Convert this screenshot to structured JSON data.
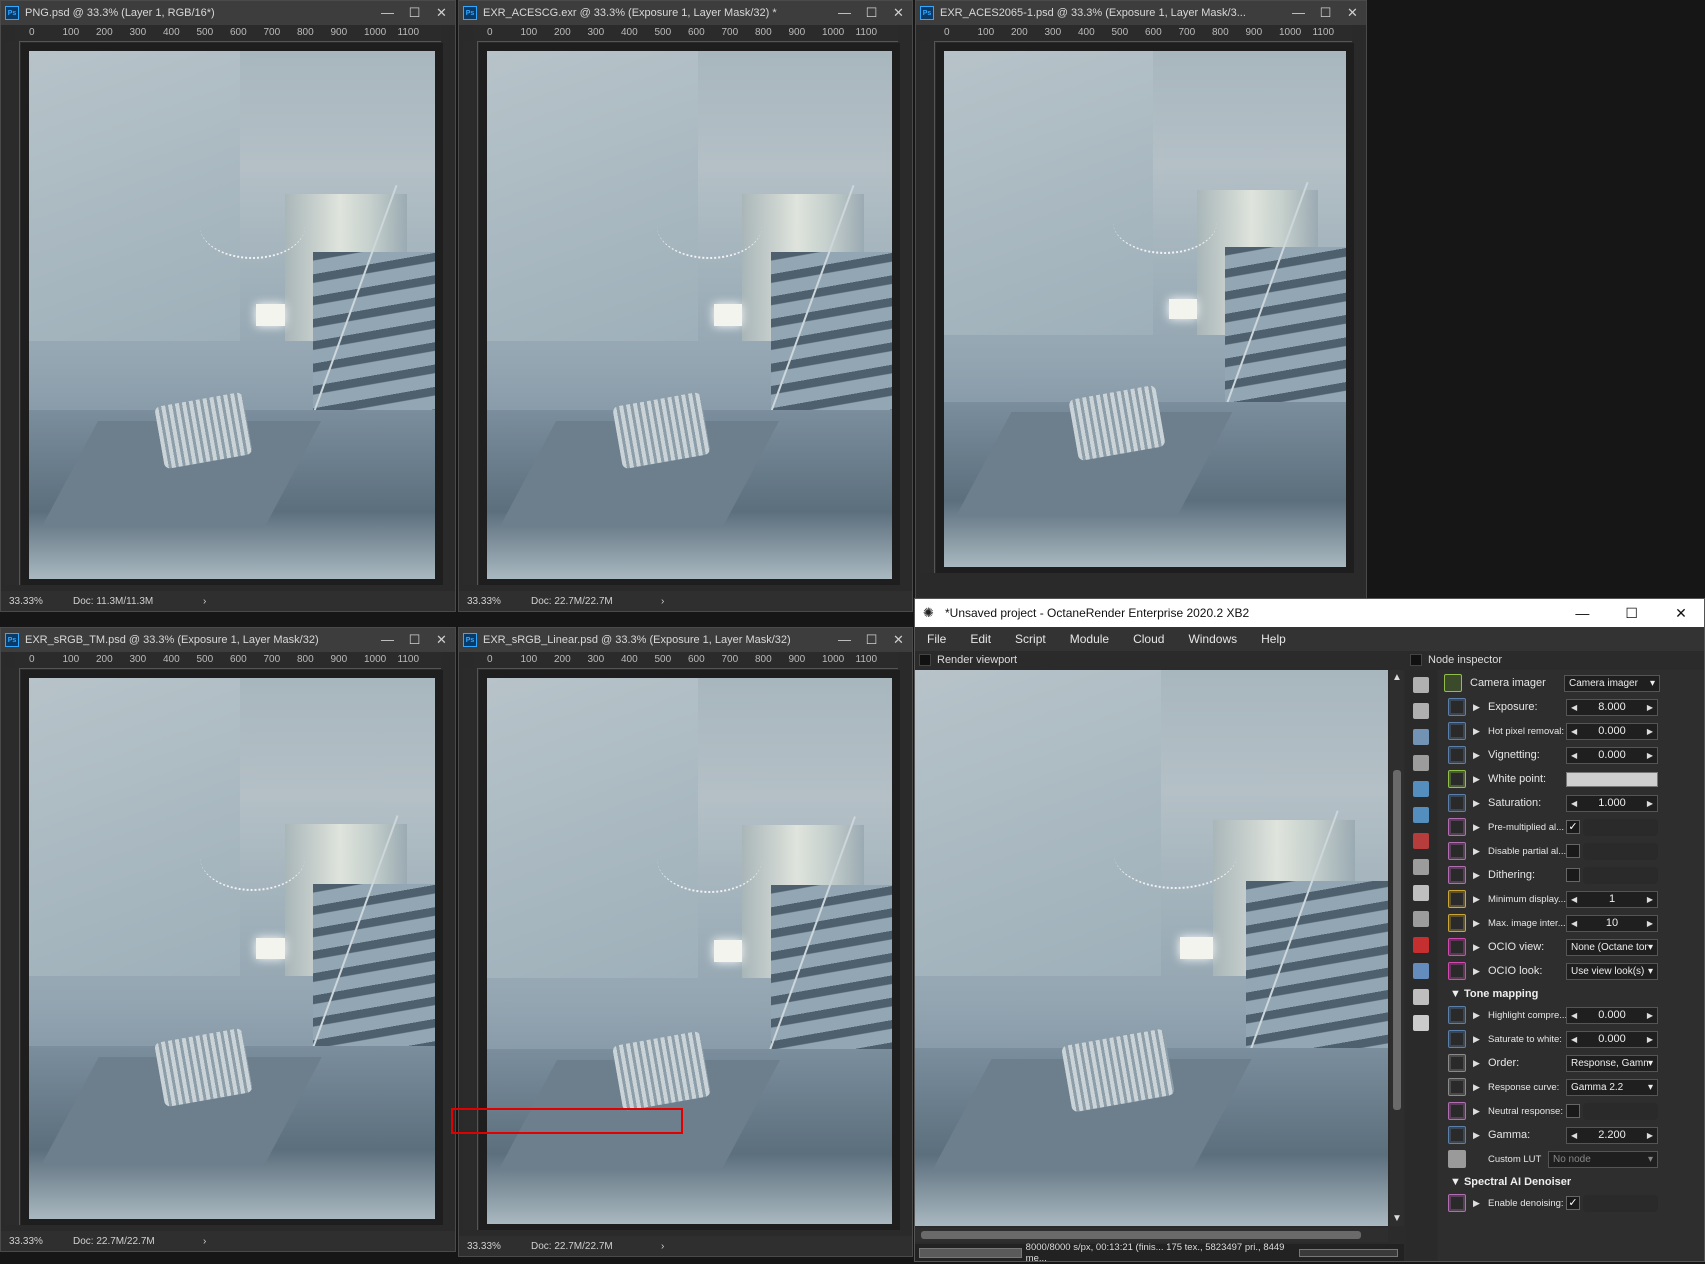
{
  "windows": [
    {
      "title": "PNG.psd @ 33.3% (Layer 1, RGB/16*)",
      "zoom": "33.33%",
      "doc": "Doc: 11.3M/11.3M"
    },
    {
      "title": "EXR_ACESCG.exr @ 33.3% (Exposure 1, Layer Mask/32) *",
      "zoom": "33.33%",
      "doc": "Doc: 22.7M/22.7M"
    },
    {
      "title": "EXR_ACES2065-1.psd @ 33.3% (Exposure 1, Layer Mask/3...",
      "zoom": "",
      "doc": ""
    },
    {
      "title": "EXR_sRGB_TM.psd @ 33.3% (Exposure 1, Layer Mask/32)",
      "zoom": "33.33%",
      "doc": "Doc: 22.7M/22.7M"
    },
    {
      "title": "EXR_sRGB_Linear.psd @ 33.3% (Exposure 1, Layer Mask/32)",
      "zoom": "33.33%",
      "doc": "Doc: 22.7M/22.7M"
    }
  ],
  "ruler_ticks": [
    "0",
    "100",
    "200",
    "300",
    "400",
    "500",
    "600",
    "700",
    "800",
    "900",
    "1000",
    "1100"
  ],
  "ps_logo": "Ps",
  "window_controls": {
    "min": "—",
    "max": "☐",
    "close": "✕"
  },
  "octane": {
    "title": "*Unsaved project - OctaneRender Enterprise 2020.2 XB2",
    "menu": [
      "File",
      "Edit",
      "Script",
      "Module",
      "Cloud",
      "Windows",
      "Help"
    ],
    "render_viewport_label": "Render viewport",
    "node_inspector_label": "Node inspector",
    "status": "8000/8000 s/px, 00:13:21 (finis... 175 tex., 5823497 pri., 8449 me...",
    "camera_imager_label": "Camera imager",
    "camera_imager_value": "Camera imager",
    "params": [
      {
        "label": "Exposure:",
        "type": "number",
        "value": "8.000",
        "color": "#5b7fa8"
      },
      {
        "label": "Hot pixel removal:",
        "type": "number",
        "value": "0.000",
        "color": "#5b7fa8",
        "small": true
      },
      {
        "label": "Vignetting:",
        "type": "number",
        "value": "0.000",
        "color": "#5b7fa8"
      },
      {
        "label": "White point:",
        "type": "swatch",
        "value": "",
        "color": "#8fbf4a"
      },
      {
        "label": "Saturation:",
        "type": "number",
        "value": "1.000",
        "color": "#5b7fa8"
      },
      {
        "label": "Pre-multiplied al...",
        "type": "check",
        "value": "✓",
        "color": "#b06db0",
        "small": true
      },
      {
        "label": "Disable partial al...",
        "type": "check",
        "value": "",
        "color": "#b06db0",
        "small": true
      },
      {
        "label": "Dithering:",
        "type": "check",
        "value": "",
        "color": "#b06db0"
      },
      {
        "label": "Minimum display...",
        "type": "number",
        "value": "1",
        "color": "#c9a53a",
        "small": true
      },
      {
        "label": "Max. image inter...",
        "type": "number",
        "value": "10",
        "color": "#c9a53a",
        "small": true
      },
      {
        "label": "OCIO view:",
        "type": "dropdown",
        "value": "None (Octane ton...",
        "color": "#d04ab0"
      },
      {
        "label": "OCIO look:",
        "type": "dropdown",
        "value": "Use view look(s)",
        "color": "#d04ab0"
      }
    ],
    "tone_mapping_label": "Tone mapping",
    "tone_params": [
      {
        "label": "Highlight compre...",
        "type": "number",
        "value": "0.000",
        "color": "#5b7fa8",
        "small": true
      },
      {
        "label": "Saturate to white:",
        "type": "number",
        "value": "0.000",
        "color": "#5b7fa8",
        "small": true
      },
      {
        "label": "Order:",
        "type": "dropdown",
        "value": "Response, Gamm...",
        "color": "#8a8a8a"
      },
      {
        "label": "Response curve:",
        "type": "dropdown",
        "value": "Gamma 2.2",
        "color": "#8a8a8a",
        "small": true
      },
      {
        "label": "Neutral response:",
        "type": "check",
        "value": "",
        "color": "#b06db0",
        "small": true
      },
      {
        "label": "Gamma:",
        "type": "number",
        "value": "2.200",
        "color": "#5b7fa8"
      }
    ],
    "custom_lut_label": "Custom LUT",
    "custom_lut_value": "No node",
    "denoiser_label": "Spectral AI Denoiser",
    "denoiser_params": [
      {
        "label": "Enable denoising:",
        "type": "check",
        "value": "✓",
        "color": "#b06db0",
        "small": true
      }
    ],
    "tool_icons": [
      "layers-icon",
      "stack-icon",
      "image-icon",
      "camera-icon",
      "environment-icon",
      "sphere-icon",
      "paint-icon",
      "texture-icon",
      "clock-icon",
      "graph-icon",
      "cube-red-icon",
      "cube-blue-icon",
      "imager-icon",
      "sun-icon"
    ],
    "tool_colors": [
      "#c8c8c8",
      "#c8c8c8",
      "#7fa6cc",
      "#b0b0b0",
      "#5aa0d8",
      "#5aa0d8",
      "#d04040",
      "#b0b0b0",
      "#d8d8d8",
      "#b0b0b0",
      "#e03030",
      "#6f9fd8",
      "#d8d8d8",
      "#e8e8e8"
    ]
  }
}
